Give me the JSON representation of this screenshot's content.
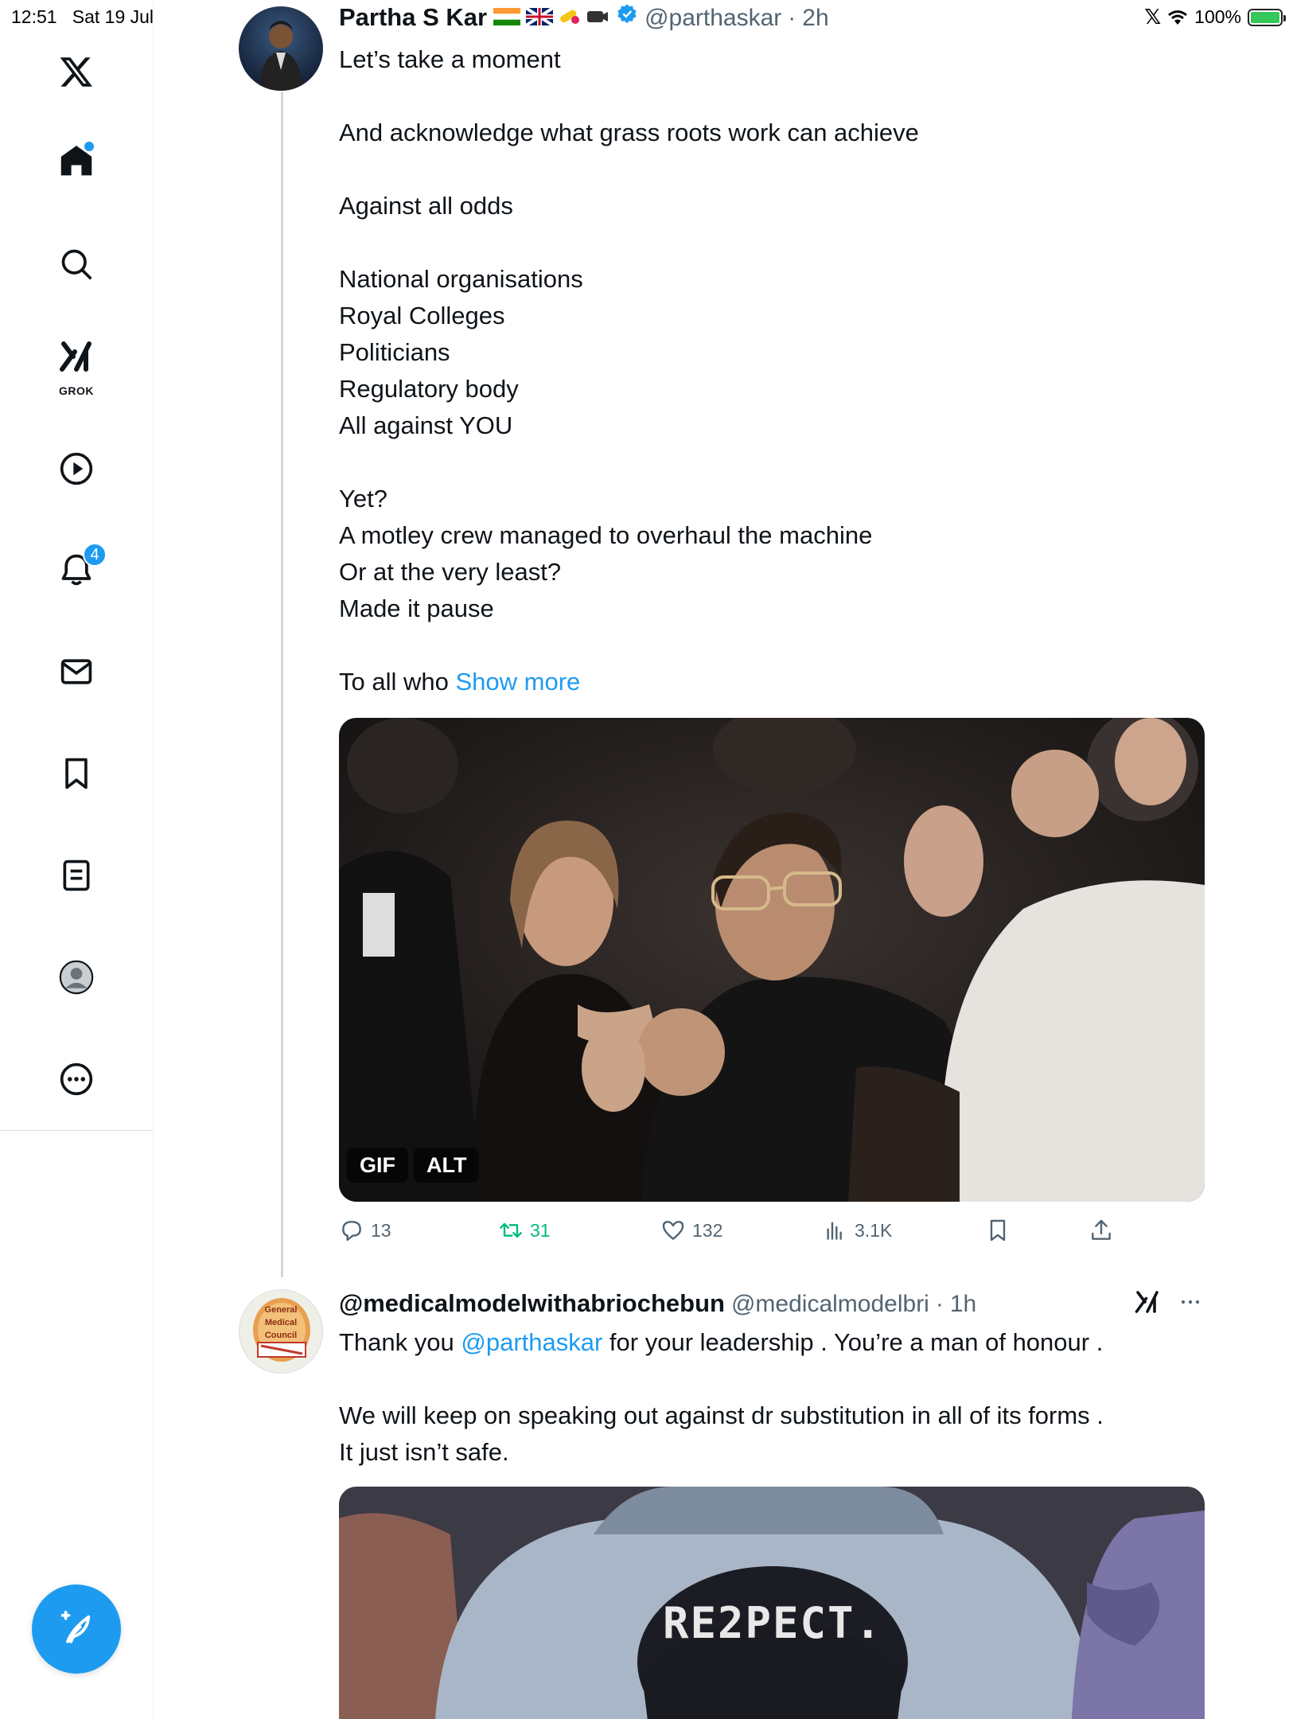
{
  "status_bar": {
    "time": "12:51",
    "date": "Sat 19 Jul",
    "battery": "100%"
  },
  "sidebar": {
    "items": [
      {
        "name": "x-logo"
      },
      {
        "name": "home",
        "has_dot": true
      },
      {
        "name": "search"
      },
      {
        "name": "grok",
        "label": "GROK"
      },
      {
        "name": "video"
      },
      {
        "name": "notifications",
        "badge": "4"
      },
      {
        "name": "messages"
      },
      {
        "name": "bookmarks"
      },
      {
        "name": "lists"
      },
      {
        "name": "profile"
      },
      {
        "name": "more"
      }
    ],
    "compose_label": "+"
  },
  "tweet1": {
    "name": "Partha S Kar",
    "handle": "@parthaskar",
    "dot": "·",
    "time": "2h",
    "lines": [
      "Let’s take a moment",
      "",
      "And acknowledge what grass roots work can achieve",
      "",
      "Against all odds",
      "",
      "National organisations",
      "Royal Colleges",
      "Politicians",
      "Regulatory body",
      "All against YOU",
      "",
      "Yet?",
      "A motley crew managed to overhaul the machine",
      "Or at the very least?",
      "Made it pause",
      ""
    ],
    "last_line_prefix": "To all who ",
    "show_more": "Show more",
    "media_gif": "GIF",
    "media_alt": "ALT",
    "replies": "13",
    "reposts": "31",
    "likes": "132",
    "views": "3.1K"
  },
  "tweet2": {
    "name": "@medicalmodelwithabriochebun",
    "handle": "@medicalmodelbri",
    "dot": "·",
    "time": "1h",
    "line1_prefix": "Thank you ",
    "line1_mention": "@parthaskar",
    "line1_suffix": " for your leadership . You’re a man of honour .",
    "line2": "We will keep on speaking out against dr substitution in all of its forms .",
    "line3": "It just isn’t safe.",
    "avatar_lines": [
      "General",
      "Medical",
      "Council"
    ],
    "cap_text": "RE2PECT."
  },
  "colors": {
    "accent": "#1d9bf0",
    "repost_green": "#00ba7c",
    "secondary_text": "#536471"
  }
}
